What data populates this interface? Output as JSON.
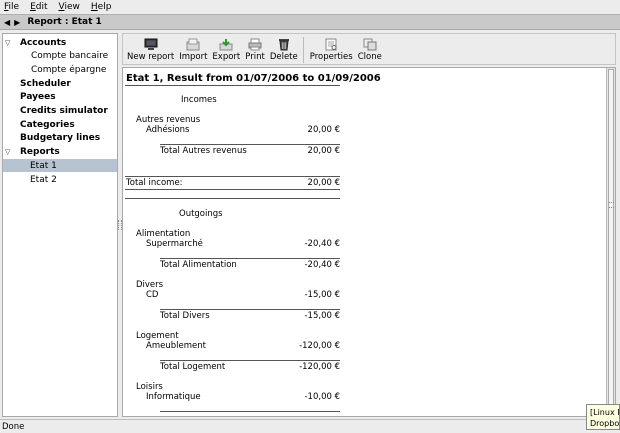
{
  "menu": [
    {
      "label": "File",
      "u": "F",
      "rest": "ile"
    },
    {
      "label": "Edit",
      "u": "E",
      "rest": "dit"
    },
    {
      "label": "View",
      "u": "V",
      "rest": "iew"
    },
    {
      "label": "Help",
      "u": "H",
      "rest": "elp"
    }
  ],
  "titlebar": {
    "title": "Report : Etat 1"
  },
  "sidebar": {
    "items": [
      {
        "label": "Accounts",
        "bold": true,
        "indent": 0,
        "expander": "▽"
      },
      {
        "label": "Compte bancaire",
        "bold": false,
        "indent": 2,
        "expander": ""
      },
      {
        "label": "Compte épargne",
        "bold": false,
        "indent": 2,
        "expander": ""
      },
      {
        "label": "Scheduler",
        "bold": true,
        "indent": 0,
        "expander": ""
      },
      {
        "label": "Payees",
        "bold": true,
        "indent": 0,
        "expander": ""
      },
      {
        "label": "Credits simulator",
        "bold": true,
        "indent": 0,
        "expander": ""
      },
      {
        "label": "Categories",
        "bold": true,
        "indent": 0,
        "expander": ""
      },
      {
        "label": "Budgetary lines",
        "bold": true,
        "indent": 0,
        "expander": ""
      },
      {
        "label": "Reports",
        "bold": true,
        "indent": 0,
        "expander": "▽"
      },
      {
        "label": "Etat 1",
        "bold": false,
        "indent": 1,
        "expander": "",
        "selected": true
      },
      {
        "label": "Etat 2",
        "bold": false,
        "indent": 1,
        "expander": ""
      }
    ]
  },
  "toolbar": {
    "new_report": "New report",
    "import": "Import",
    "export": "Export",
    "print": "Print",
    "delete": "Delete",
    "properties": "Properties",
    "clone": "Clone"
  },
  "report": {
    "title": "Etat 1, Result from 01/07/2006 to 01/09/2006",
    "incomes_header": "Incomes",
    "incomes": {
      "category": "Autres revenus",
      "line": {
        "label": "Adhésions",
        "value": "20,00 €"
      },
      "total": {
        "label": "Total Autres revenus",
        "value": "20,00 €"
      }
    },
    "total_income": {
      "label": "Total income:",
      "value": "20,00 €"
    },
    "outgoings_header": "Outgoings",
    "outgoings": [
      {
        "category": "Alimentation",
        "line_label": "Supermarché",
        "line_value": "-20,40 €",
        "total_label": "Total Alimentation",
        "total_value": "-20,40 €"
      },
      {
        "category": "Divers",
        "line_label": "CD",
        "line_value": "-15,00 €",
        "total_label": "Total Divers",
        "total_value": "-15,00 €"
      },
      {
        "category": "Logement",
        "line_label": "Ameublement",
        "line_value": "-120,00 €",
        "total_label": "Total Logement",
        "total_value": "-120,00 €"
      },
      {
        "category": "Loisirs",
        "line_label": "Informatique",
        "line_value": "-10,00 €"
      }
    ]
  },
  "status": {
    "text": "Done"
  },
  "tooltip": {
    "line1": "[Linux P",
    "line2": "Dropbo"
  }
}
